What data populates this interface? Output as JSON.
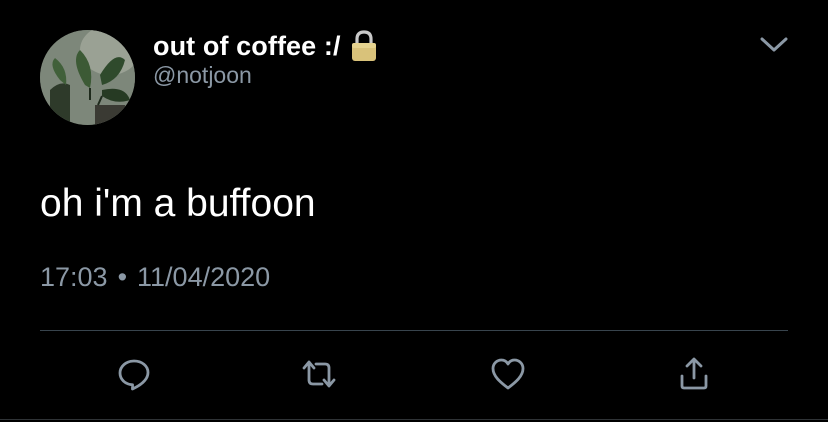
{
  "user": {
    "display_name": "out of coffee :/",
    "handle": "@notjoon",
    "protected": true
  },
  "tweet": {
    "text": "oh i'm a buffoon",
    "time": "17:03",
    "separator": "•",
    "date": "11/04/2020"
  },
  "icons": {
    "avatar": "plant-photo-avatar",
    "protected": "lock-icon",
    "menu": "chevron-down-icon",
    "reply": "reply-icon",
    "retweet": "retweet-icon",
    "like": "heart-icon",
    "share": "share-icon"
  },
  "colors": {
    "background": "#000000",
    "primary_text": "#ffffff",
    "secondary_text": "#8b98a5",
    "divider": "#38444d",
    "lock": "#d9c27a"
  }
}
